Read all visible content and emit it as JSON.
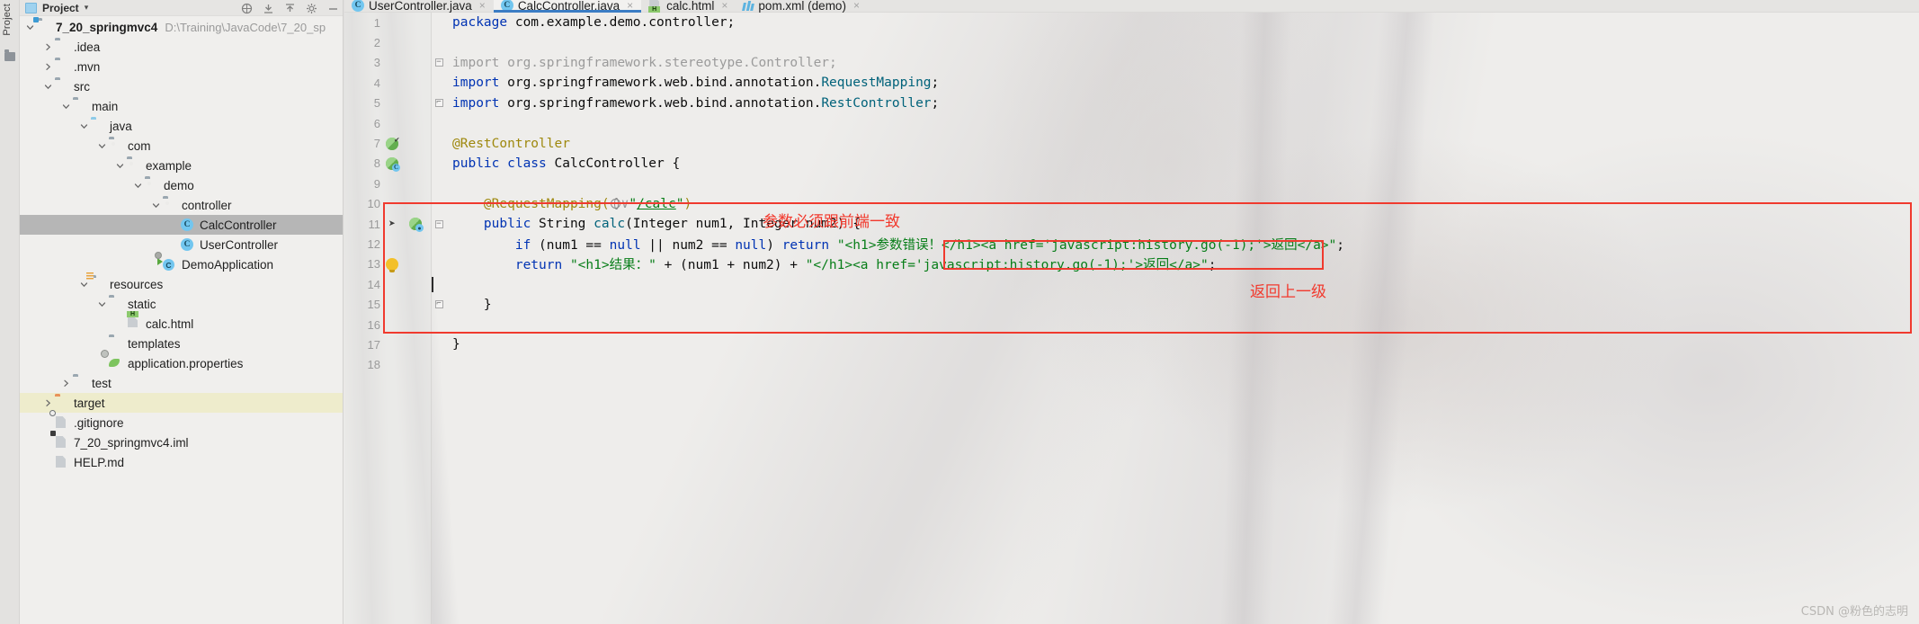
{
  "toolstrip": {
    "label": "Project"
  },
  "panel": {
    "title": "Project",
    "caret": "▾",
    "icons": [
      "collapse-all-icon",
      "expand-all-icon",
      "settings-icon",
      "hide-icon"
    ]
  },
  "tree": [
    {
      "indent": 0,
      "arrow": "down",
      "icon": "module-folder",
      "label": "7_20_springmvc4",
      "bold": true,
      "path": "D:\\Training\\JavaCode\\7_20_sp",
      "state": "normal"
    },
    {
      "indent": 1,
      "arrow": "right",
      "icon": "folder",
      "label": ".idea",
      "state": "normal"
    },
    {
      "indent": 1,
      "arrow": "right",
      "icon": "folder",
      "label": ".mvn",
      "state": "normal"
    },
    {
      "indent": 1,
      "arrow": "down",
      "icon": "folder",
      "label": "src",
      "state": "normal"
    },
    {
      "indent": 2,
      "arrow": "down",
      "icon": "folder",
      "label": "main",
      "state": "normal"
    },
    {
      "indent": 3,
      "arrow": "down",
      "icon": "folder-source",
      "label": "java",
      "state": "normal"
    },
    {
      "indent": 4,
      "arrow": "down",
      "icon": "folder-package",
      "label": "com",
      "state": "normal"
    },
    {
      "indent": 5,
      "arrow": "down",
      "icon": "folder-package",
      "label": "example",
      "state": "normal"
    },
    {
      "indent": 6,
      "arrow": "down",
      "icon": "folder-package",
      "label": "demo",
      "state": "normal"
    },
    {
      "indent": 7,
      "arrow": "down",
      "icon": "folder-package",
      "label": "controller",
      "state": "normal"
    },
    {
      "indent": 8,
      "arrow": "none",
      "icon": "java-class",
      "label": "CalcController",
      "state": "selected"
    },
    {
      "indent": 8,
      "arrow": "none",
      "icon": "java-class",
      "label": "UserController",
      "state": "normal"
    },
    {
      "indent": 7,
      "arrow": "none",
      "icon": "spring-boot-app",
      "label": "DemoApplication",
      "state": "normal"
    },
    {
      "indent": 3,
      "arrow": "down",
      "icon": "folder-resources",
      "label": "resources",
      "state": "normal"
    },
    {
      "indent": 4,
      "arrow": "down",
      "icon": "folder",
      "label": "static",
      "state": "normal"
    },
    {
      "indent": 5,
      "arrow": "none",
      "icon": "html-file",
      "label": "calc.html",
      "state": "normal"
    },
    {
      "indent": 4,
      "arrow": "none",
      "icon": "folder",
      "label": "templates",
      "state": "normal"
    },
    {
      "indent": 4,
      "arrow": "none",
      "icon": "properties-file",
      "label": "application.properties",
      "state": "normal"
    },
    {
      "indent": 2,
      "arrow": "right",
      "icon": "folder",
      "label": "test",
      "state": "normal"
    },
    {
      "indent": 1,
      "arrow": "right",
      "icon": "folder-target",
      "label": "target",
      "state": "highlighted"
    },
    {
      "indent": 1,
      "arrow": "none",
      "icon": "gitignore-file",
      "label": ".gitignore",
      "state": "normal"
    },
    {
      "indent": 1,
      "arrow": "none",
      "icon": "iml-file",
      "label": "7_20_springmvc4.iml",
      "state": "normal"
    },
    {
      "indent": 1,
      "arrow": "none",
      "icon": "md-file",
      "label": "HELP.md",
      "state": "normal"
    }
  ],
  "tabs": [
    {
      "label": "UserController.java",
      "icon": "java-class",
      "active": false,
      "close": "×"
    },
    {
      "label": "CalcController.java",
      "icon": "java-class",
      "active": true,
      "close": "×"
    },
    {
      "label": "calc.html",
      "icon": "html-file",
      "active": false,
      "close": "×"
    },
    {
      "label": "pom.xml (demo)",
      "icon": "maven-file",
      "active": false,
      "close": "×"
    }
  ],
  "code": {
    "lines": [
      {
        "n": "1",
        "gutter": "",
        "fold": "",
        "segments": [
          {
            "t": "package ",
            "c": "kw"
          },
          {
            "t": "com.example.demo.controller;",
            "c": "plain"
          }
        ]
      },
      {
        "n": "2",
        "gutter": "",
        "fold": "",
        "segments": []
      },
      {
        "n": "3",
        "gutter": "",
        "fold": "foldbox-minus",
        "segments": [
          {
            "t": "import org.springframework.stereotype.Controller;",
            "c": "grey"
          }
        ]
      },
      {
        "n": "4",
        "gutter": "",
        "fold": "",
        "segments": [
          {
            "t": "import ",
            "c": "kw"
          },
          {
            "t": "org.springframework.web.bind.annotation.",
            "c": "plain"
          },
          {
            "t": "RequestMapping",
            "c": "mth"
          },
          {
            "t": ";",
            "c": "plain"
          }
        ]
      },
      {
        "n": "5",
        "gutter": "",
        "fold": "foldbox-end",
        "segments": [
          {
            "t": "import ",
            "c": "kw"
          },
          {
            "t": "org.springframework.web.bind.annotation.",
            "c": "plain"
          },
          {
            "t": "RestController",
            "c": "mth"
          },
          {
            "t": ";",
            "c": "plain"
          }
        ]
      },
      {
        "n": "6",
        "gutter": "",
        "fold": "",
        "segments": []
      },
      {
        "n": "7",
        "gutter": "spring-bean-check",
        "fold": "",
        "segments": [
          {
            "t": "@RestController",
            "c": "anno"
          }
        ]
      },
      {
        "n": "8",
        "gutter": "spring-bean-class",
        "fold": "",
        "segments": [
          {
            "t": "public ",
            "c": "kw"
          },
          {
            "t": "class ",
            "c": "kw"
          },
          {
            "t": "CalcController ",
            "c": "plain"
          },
          {
            "t": "{",
            "c": "plain"
          }
        ]
      },
      {
        "n": "9",
        "gutter": "",
        "fold": "",
        "segments": []
      },
      {
        "n": "10",
        "gutter": "",
        "fold": "",
        "segments": [
          {
            "t": "    @RequestMapping(",
            "c": "anno"
          },
          {
            "t": "GLOBE",
            "c": "icon"
          },
          {
            "t": "∨",
            "c": "grey"
          },
          {
            "t": "\"",
            "c": "str"
          },
          {
            "t": "/calc",
            "c": "lnk"
          },
          {
            "t": "\"",
            "c": "str"
          },
          {
            "t": ")",
            "c": "anno"
          }
        ]
      },
      {
        "n": "11",
        "gutter": "rocket-run",
        "fold": "foldbox-minus",
        "segments": [
          {
            "t": "    public ",
            "c": "kw"
          },
          {
            "t": "String ",
            "c": "plain"
          },
          {
            "t": "calc",
            "c": "mth"
          },
          {
            "t": "(Integer num1, Integer num2) {",
            "c": "plain"
          }
        ]
      },
      {
        "n": "12",
        "gutter": "",
        "fold": "",
        "segments": [
          {
            "t": "        ",
            "c": "plain"
          },
          {
            "t": "if ",
            "c": "kw"
          },
          {
            "t": "(num1 == ",
            "c": "plain"
          },
          {
            "t": "null ",
            "c": "kw"
          },
          {
            "t": "|| num2 == ",
            "c": "plain"
          },
          {
            "t": "null",
            "c": "kw"
          },
          {
            "t": ") ",
            "c": "plain"
          },
          {
            "t": "return ",
            "c": "kw"
          },
          {
            "t": "\"<h1>参数错误！</h1><a href='javascript:history.go(-1);'>返回</a>\"",
            "c": "str"
          },
          {
            "t": ";",
            "c": "plain"
          }
        ]
      },
      {
        "n": "13",
        "gutter": "intention-bulb",
        "fold": "",
        "segments": [
          {
            "t": "        ",
            "c": "plain"
          },
          {
            "t": "return ",
            "c": "kw"
          },
          {
            "t": "\"<h1>结果：\" ",
            "c": "str"
          },
          {
            "t": "+ (num1 + num2) + ",
            "c": "plain"
          },
          {
            "t": "\"</h1><a href='javascript:history.go(-1);'>返回</a>\"",
            "c": "str"
          },
          {
            "t": ";",
            "c": "plain"
          }
        ]
      },
      {
        "n": "14",
        "gutter": "",
        "fold": "",
        "segments": [],
        "caret": true
      },
      {
        "n": "15",
        "gutter": "",
        "fold": "foldbox-end",
        "segments": [
          {
            "t": "    }",
            "c": "plain"
          }
        ]
      },
      {
        "n": "16",
        "gutter": "",
        "fold": "",
        "segments": []
      },
      {
        "n": "17",
        "gutter": "",
        "fold": "",
        "segments": [
          {
            "t": "}",
            "c": "plain"
          }
        ]
      },
      {
        "n": "18",
        "gutter": "",
        "fold": "",
        "segments": []
      }
    ]
  },
  "annotations": {
    "color": "#f2392d",
    "outer_box_label": "outer-highlight-box",
    "inner_box_label": "inner-highlight-box",
    "note_params": "参数必须跟前端一致",
    "note_back": "返回上一级"
  },
  "watermark": "CSDN @粉色的志明"
}
